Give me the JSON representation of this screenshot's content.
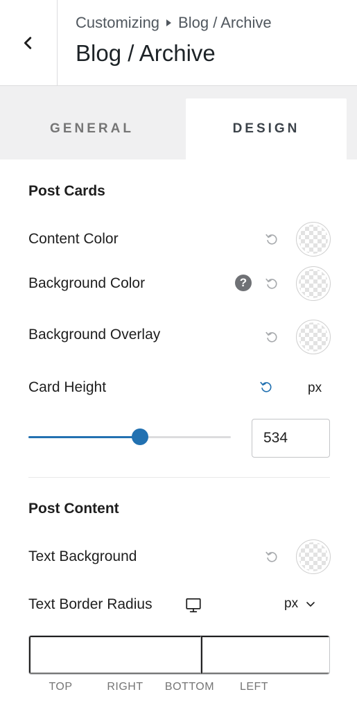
{
  "header": {
    "breadcrumb_root": "Customizing",
    "breadcrumb_current": "Blog / Archive",
    "title": "Blog / Archive"
  },
  "tabs": [
    {
      "label": "GENERAL",
      "active": false
    },
    {
      "label": "DESIGN",
      "active": true
    }
  ],
  "post_cards": {
    "title": "Post Cards",
    "content_color_label": "Content Color",
    "background_color_label": "Background Color",
    "help_icon_glyph": "?",
    "background_overlay_label": "Background Overlay",
    "card_height_label": "Card Height",
    "card_height_unit": "px",
    "card_height_value": "534",
    "card_height_slider_fraction": 0.55
  },
  "post_content": {
    "title": "Post Content",
    "text_background_label": "Text Background",
    "text_border_radius_label": "Text Border Radius",
    "radius_unit": "px",
    "radius_values": [
      "",
      "",
      "",
      ""
    ],
    "radius_labels": [
      "TOP",
      "RIGHT",
      "BOTTOM",
      "LEFT"
    ]
  },
  "icons": {
    "back": "chevron-left-icon",
    "reset": "reset-icon",
    "help": "help-icon",
    "device": "desktop-icon",
    "dropdown": "chevron-down-icon",
    "link": "unlink-icon"
  },
  "colors": {
    "accent": "#2271b1",
    "reset_active": "#2271b1",
    "reset_inactive": "#a7aaad"
  }
}
